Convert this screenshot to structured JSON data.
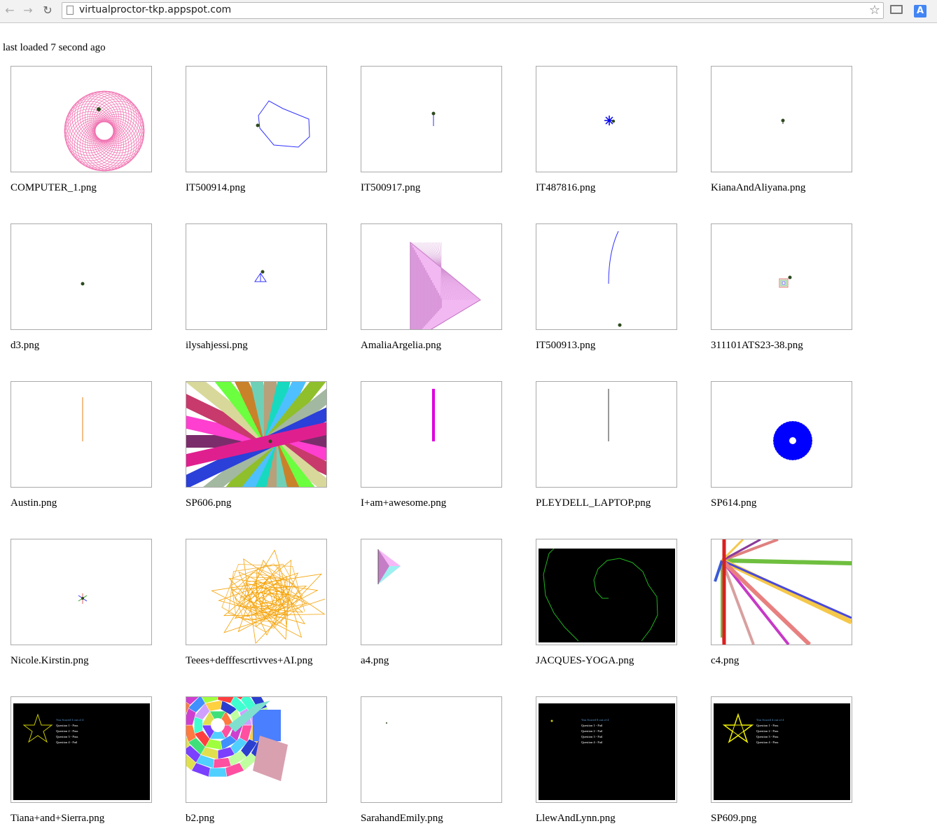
{
  "browser": {
    "url": "virtualproctor-tkp.appspot.com",
    "translate_label": "A"
  },
  "status_text": "last loaded 7 second ago",
  "files": [
    {
      "name": "COMPUTER_1.png"
    },
    {
      "name": "IT500914.png"
    },
    {
      "name": "IT500917.png"
    },
    {
      "name": "IT487816.png"
    },
    {
      "name": "KianaAndAliyana.png"
    },
    {
      "name": "d3.png"
    },
    {
      "name": "ilysahjessi.png"
    },
    {
      "name": "AmaliaArgelia.png"
    },
    {
      "name": "IT500913.png"
    },
    {
      "name": "311101ATS23-38.png"
    },
    {
      "name": "Austin.png"
    },
    {
      "name": "SP606.png"
    },
    {
      "name": "I+am+awesome.png"
    },
    {
      "name": "PLEYDELL_LAPTOP.png"
    },
    {
      "name": "SP614.png"
    },
    {
      "name": "Nicole.Kirstin.png"
    },
    {
      "name": "Teees+defffescrtivves+AI.png"
    },
    {
      "name": "a4.png"
    },
    {
      "name": "JACQUES-YOGA.png"
    },
    {
      "name": "c4.png"
    },
    {
      "name": "Tiana+and+Sierra.png",
      "quiz": {
        "score": "You Scored 3 out of 4",
        "q1": "Question 1 - Pass",
        "q2": "Question 2 - Pass",
        "q3": "Question 3 - Pass",
        "q4": "Question 4 - Fail"
      }
    },
    {
      "name": "b2.png"
    },
    {
      "name": "SarahandEmily.png"
    },
    {
      "name": "LlewAndLynn.png",
      "quiz": {
        "score": "You Scored 0 out of 4",
        "q1": "Question 1 - Fail",
        "q2": "Question 2 - Fail",
        "q3": "Question 3 - Fail",
        "q4": "Question 4 - Fail"
      }
    },
    {
      "name": "SP609.png",
      "quiz": {
        "score": "You Scored 4 out of 4",
        "q1": "Question 1 - Pass",
        "q2": "Question 2 - Pass",
        "q3": "Question 3 - Pass",
        "q4": "Question 4 - Pass"
      }
    }
  ]
}
